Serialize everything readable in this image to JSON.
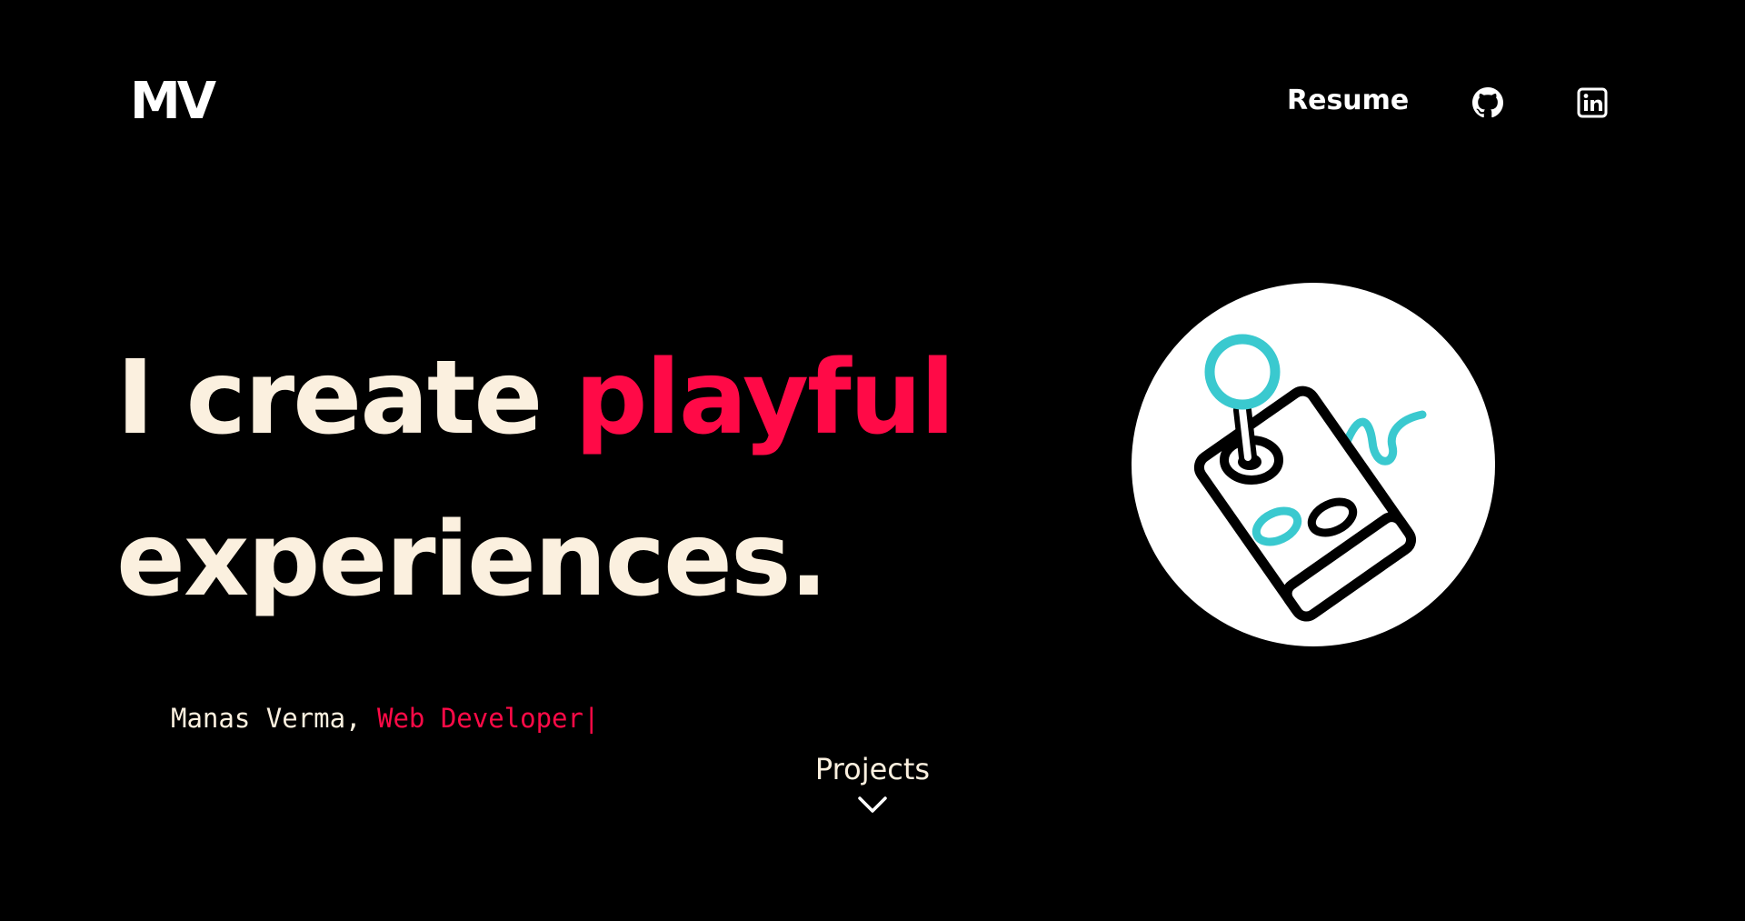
{
  "header": {
    "logo_text": "MV",
    "nav": {
      "resume_label": "Resume",
      "github_icon": "github-icon",
      "linkedin_icon": "linkedin-icon"
    }
  },
  "hero": {
    "headline": {
      "line1_plain": "I create ",
      "line1_accent": "playful",
      "line2": "experiences."
    },
    "tagline": {
      "name": "Manas Verma, ",
      "role": "Web Developer",
      "cursor": "|"
    },
    "illustration_icon": "joystick-icon"
  },
  "scroll_cta": {
    "label": "Projects",
    "icon": "chevron-down-icon"
  },
  "colors": {
    "background": "#000000",
    "text_cream": "#fbf0df",
    "accent_red": "#ff0a47",
    "accent_teal": "#3ac9cf",
    "white": "#ffffff"
  }
}
